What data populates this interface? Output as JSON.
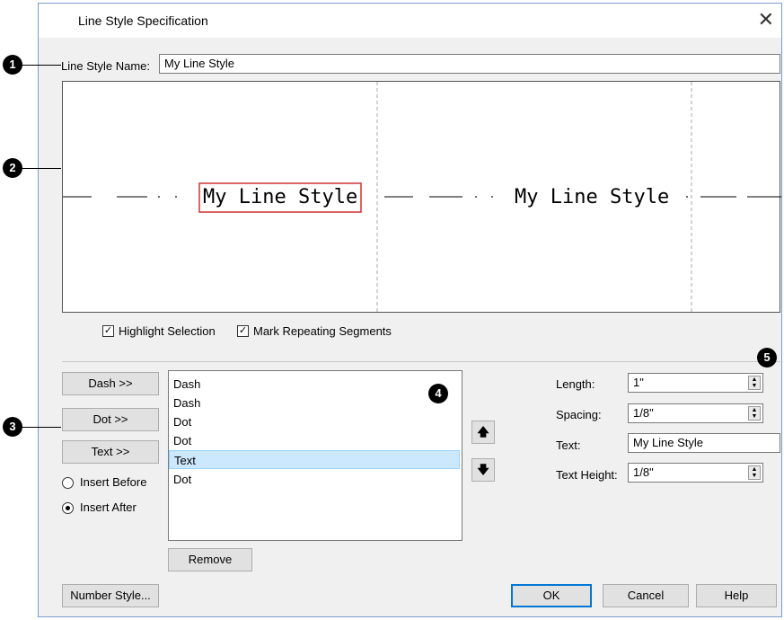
{
  "window": {
    "title": "Line Style Specification",
    "close_glyph": "✕"
  },
  "callouts": [
    "1",
    "2",
    "3",
    "4",
    "5"
  ],
  "name_label": "Line Style Name:",
  "name_value": "My Line Style",
  "preview": {
    "text_1": "My Line Style",
    "text_2": "My Line Style",
    "selection_color": "#d03030"
  },
  "options": {
    "highlight_selection": "Highlight Selection",
    "mark_repeating": "Mark Repeating Segments",
    "highlight_checked": true,
    "mark_checked": true
  },
  "segment_buttons": {
    "dash": "Dash >>",
    "dot": "Dot >>",
    "text": "Text >>"
  },
  "insert": {
    "before": "Insert Before",
    "after": "Insert After",
    "selected": "after"
  },
  "segments": [
    "Dash",
    "Dash",
    "Dot",
    "Dot",
    "Text",
    "Dot"
  ],
  "selected_segment_index": 4,
  "move_up_glyph": "🡅",
  "move_down_glyph": "🡇",
  "remove_label": "Remove",
  "props": {
    "length_label": "Length:",
    "length_value": "1\"",
    "spacing_label": "Spacing:",
    "spacing_value": "1/8\"",
    "text_label": "Text:",
    "text_value": "My Line Style",
    "height_label": "Text Height:",
    "height_value": "1/8\""
  },
  "footer": {
    "number_style": "Number Style...",
    "ok": "OK",
    "cancel": "Cancel",
    "help": "Help"
  },
  "colors": {
    "accent": "#0078d7",
    "selection_bg": "#cce8ff"
  }
}
